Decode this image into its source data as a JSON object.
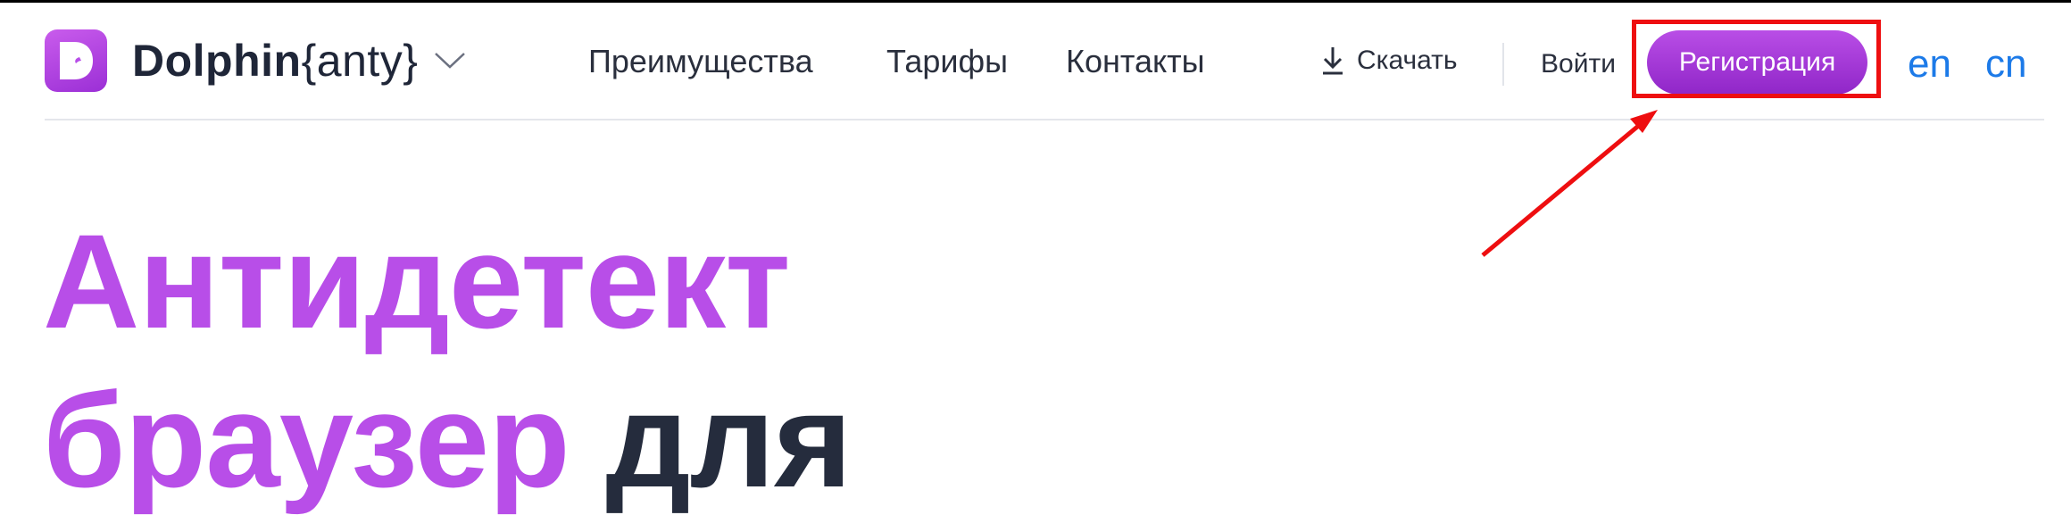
{
  "header": {
    "logo": {
      "brand": "Dolphin",
      "suffix": "{anty}",
      "mark_letter": "D"
    },
    "nav": [
      {
        "label": "Преимущества"
      },
      {
        "label": "Тарифы"
      },
      {
        "label": "Контакты"
      }
    ],
    "download_label": "Скачать",
    "login_label": "Войти",
    "register_label": "Регистрация",
    "languages": [
      "en",
      "cn"
    ]
  },
  "hero": {
    "line1": "Антидетект",
    "line2_accent": "браузер",
    "line2_dark": "для"
  },
  "colors": {
    "accent": "#b84ee8",
    "button": "#9f35d4",
    "link": "#1c7ae8",
    "annotation": "#ee0e10",
    "dark_text": "#252c3d"
  },
  "icons": {
    "download": "download-icon",
    "chevron": "chevron-down-icon",
    "logo": "dolphin-logo-icon"
  }
}
